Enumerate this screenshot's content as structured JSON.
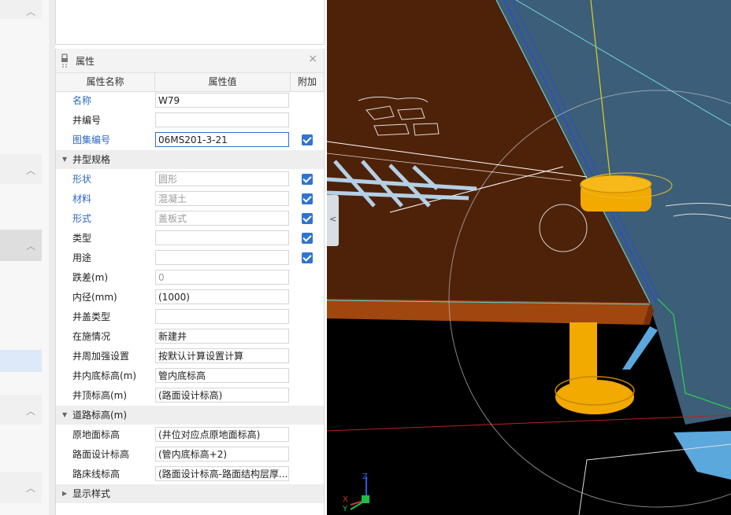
{
  "properties_panel": {
    "title": "属性",
    "columns": {
      "name": "属性名称",
      "value": "属性值",
      "extra": "附加"
    },
    "rows": [
      {
        "name": "名称",
        "value": "W79"
      },
      {
        "name": "井编号",
        "value": ""
      },
      {
        "name": "图集编号",
        "value": "06MS201-3-21",
        "checked": true
      },
      {
        "name": "井型规格"
      },
      {
        "name": "形状",
        "value": "圆形",
        "checked": true
      },
      {
        "name": "材料",
        "value": "混凝土",
        "checked": true
      },
      {
        "name": "形式",
        "value": "盖板式",
        "checked": true
      },
      {
        "name": "类型",
        "value": "",
        "checked": true
      },
      {
        "name": "用途",
        "value": "",
        "checked": true
      },
      {
        "name": "跌差(m)",
        "value": "0"
      },
      {
        "name": "内径(mm)",
        "value": "(1000)"
      },
      {
        "name": "井盖类型",
        "value": ""
      },
      {
        "name": "在施情况",
        "value": "新建井"
      },
      {
        "name": "井周加强设置",
        "value": "按默认计算设置计算"
      },
      {
        "name": "井内底标高(m)",
        "value": "管内底标高"
      },
      {
        "name": "井顶标高(m)",
        "value": "(路面设计标高)"
      },
      {
        "name": "道路标高(m)"
      },
      {
        "name": "原地面标高",
        "value": "(井位对应点原地面标高)"
      },
      {
        "name": "路面设计标高",
        "value": "(管内底标高+2)"
      },
      {
        "name": "路床线标高",
        "value": "(路面设计标高-路面结构层厚..."
      },
      {
        "name": "显示样式"
      }
    ]
  },
  "viewport": {
    "axis_labels": {
      "z": "Z",
      "x": "X",
      "y": "Y"
    },
    "colors": {
      "background": "#000000",
      "slab_top": "#4e2209",
      "slab_edge": "#a0460f",
      "water_panel": "#3c5e78",
      "manhole": "#f2a900",
      "hatch": "#bfe3ff",
      "accent_blue": "#2f74d0"
    }
  },
  "icons": {
    "close": "×",
    "chevron_up": "︿",
    "collapse": "<"
  }
}
